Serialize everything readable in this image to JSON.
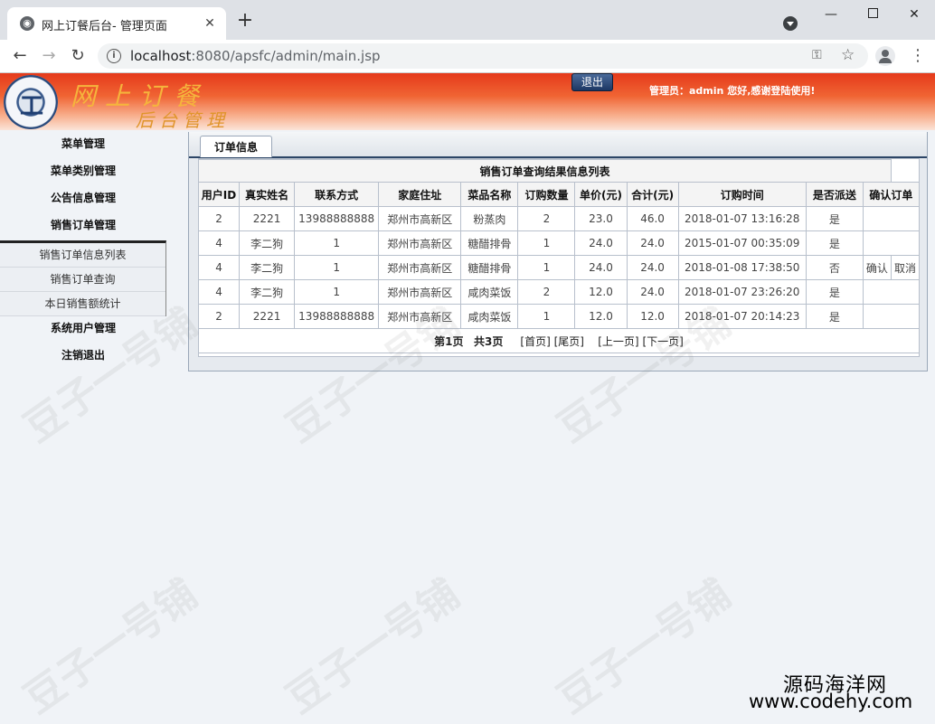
{
  "browser": {
    "tab_title": "网上订餐后台- 管理页面",
    "url_host": "localhost",
    "url_path": ":8080/apsfc/admin/main.jsp"
  },
  "header": {
    "brand_line1": "网上订餐",
    "brand_line2": "后台管理",
    "logout_label": "退出",
    "admin_greeting": "管理员：admin 您好,感谢登陆使用!"
  },
  "sidebar": {
    "items": [
      {
        "label": "菜单管理"
      },
      {
        "label": "菜单类别管理"
      },
      {
        "label": "公告信息管理"
      },
      {
        "label": "销售订单管理"
      }
    ],
    "submenu": [
      {
        "label": "销售订单信息列表"
      },
      {
        "label": "销售订单查询"
      },
      {
        "label": "本日销售额统计"
      }
    ],
    "bottom_items": [
      {
        "label": "系统用户管理"
      },
      {
        "label": "注销退出"
      }
    ]
  },
  "panel": {
    "tab_label": "订单信息",
    "table_caption": "销售订单查询结果信息列表",
    "columns": [
      "用户ID",
      "真实姓名",
      "联系方式",
      "家庭住址",
      "菜品名称",
      "订购数量",
      "单价(元)",
      "合计(元)",
      "订购时间",
      "是否派送",
      "确认订单"
    ],
    "rows": [
      {
        "uid": "2",
        "name": "2221",
        "phone": "13988888888",
        "addr": "郑州市高新区",
        "dish": "粉蒸肉",
        "qty": "2",
        "price": "23.0",
        "total": "46.0",
        "time": "2018-01-07 13:16:28",
        "sent": "是",
        "confirm": "",
        "cancel": ""
      },
      {
        "uid": "4",
        "name": "李二狗",
        "phone": "1",
        "addr": "郑州市高新区",
        "dish": "糖醋排骨",
        "qty": "1",
        "price": "24.0",
        "total": "24.0",
        "time": "2015-01-07 00:35:09",
        "sent": "是",
        "confirm": "",
        "cancel": ""
      },
      {
        "uid": "4",
        "name": "李二狗",
        "phone": "1",
        "addr": "郑州市高新区",
        "dish": "糖醋排骨",
        "qty": "1",
        "price": "24.0",
        "total": "24.0",
        "time": "2018-01-08 17:38:50",
        "sent": "否",
        "confirm": "确认",
        "cancel": "取消"
      },
      {
        "uid": "4",
        "name": "李二狗",
        "phone": "1",
        "addr": "郑州市高新区",
        "dish": "咸肉菜饭",
        "qty": "2",
        "price": "12.0",
        "total": "24.0",
        "time": "2018-01-07 23:26:20",
        "sent": "是",
        "confirm": "",
        "cancel": ""
      },
      {
        "uid": "2",
        "name": "2221",
        "phone": "13988888888",
        "addr": "郑州市高新区",
        "dish": "咸肉菜饭",
        "qty": "1",
        "price": "12.0",
        "total": "12.0",
        "time": "2018-01-07 20:14:23",
        "sent": "是",
        "confirm": "",
        "cancel": ""
      }
    ],
    "pager": {
      "page_info": "第1页",
      "total_info": "共3页",
      "first": "[首页]",
      "last": "[尾页]",
      "prev": "[上一页]",
      "next": "[下一页]"
    }
  },
  "watermark": {
    "cn": "源码海洋网",
    "url": "www.codehy.com",
    "faint": "豆子一号铺"
  }
}
